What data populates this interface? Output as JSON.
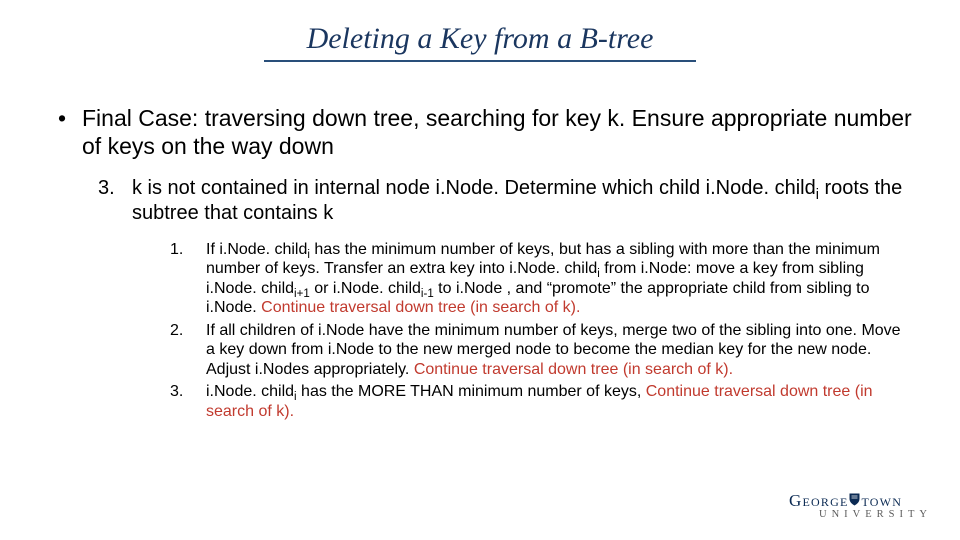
{
  "title": "Deleting a Key from a B-tree",
  "bullet1": "Final Case: traversing down tree, searching for key k. Ensure appropriate number of keys on the way down",
  "step3": {
    "num": "3.",
    "a": "k is not contained in internal node i.Node. Determine which child i.Node. child",
    "sub": "i",
    "b": " roots the subtree that contains k"
  },
  "sub1": {
    "num": "1.",
    "t1": "If i.Node. child",
    "s1": "i",
    "t2": " has the minimum number of keys, but has a sibling with more than the minimum number of keys. Transfer an extra key into i.Node. child",
    "s2": "i",
    "t3": " from i.Node: move a key from sibling  i.Node. child",
    "s3": "i+1",
    "t4": " or i.Node. child",
    "s4": "i-1",
    "t5": " to i.Node , and “promote” the appropriate child from sibling to i.Node. ",
    "red": "Continue traversal down tree (in search of k)."
  },
  "sub2": {
    "num": "2.",
    "t1": "If all children of i.Node have the minimum number of keys, merge two of the sibling into one. Move a key down from i.Node to the new merged node to become the median key for the new node. Adjust i.Nodes appropriately. ",
    "red": "Continue traversal down tree (in search of k)."
  },
  "sub3": {
    "num": "3.",
    "t1": "i.Node. child",
    "s1": "i",
    "t2": " has the MORE THAN minimum number of keys, ",
    "red": "Continue traversal down tree (in search of k)."
  },
  "logo": {
    "line1a": "George",
    "line1b": "town",
    "line2": "UNIVERSITY"
  }
}
